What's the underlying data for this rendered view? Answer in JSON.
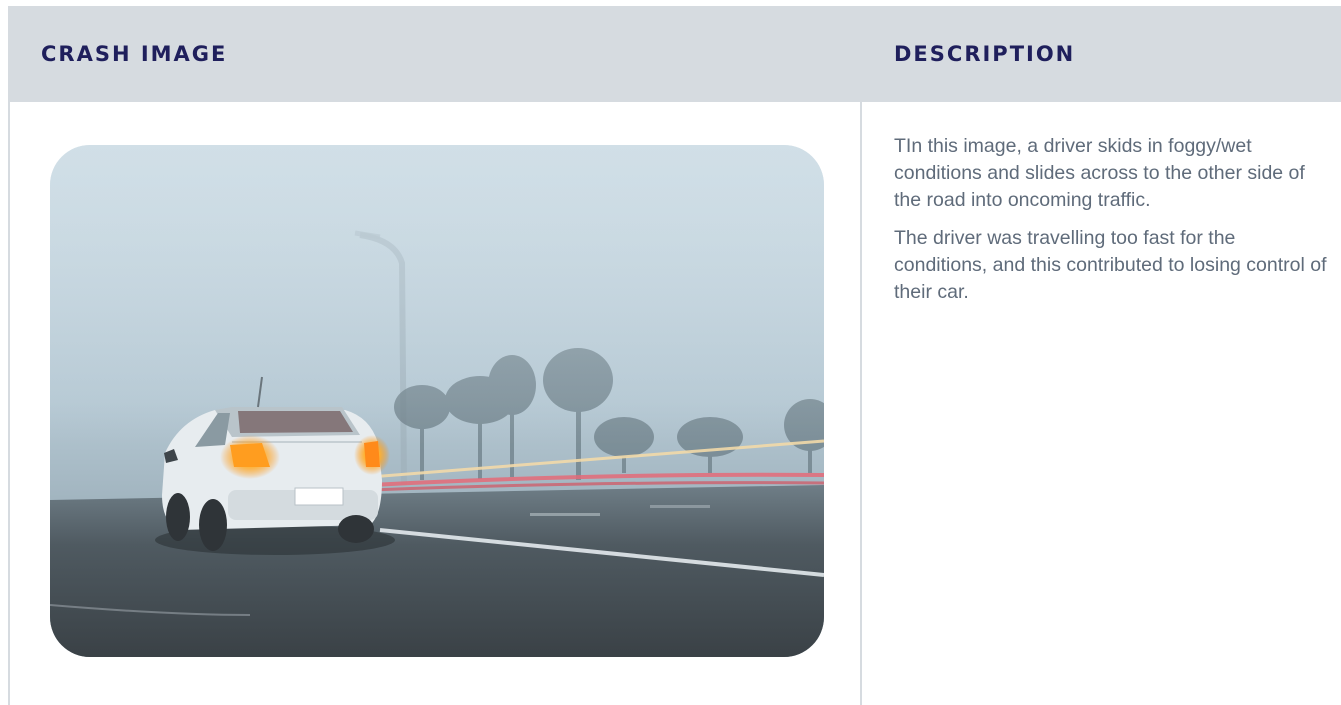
{
  "table": {
    "headers": [
      "CRASH IMAGE",
      "DESCRIPTION"
    ]
  },
  "image": {
    "icon": "crash-photo-foggy-road"
  },
  "description": {
    "paragraphs": [
      "TIn this image, a driver skids in foggy/wet conditions and slides across to the other side of the road into oncoming traffic.",
      "The driver was travelling too fast for the conditions, and this contributed to losing control of their car."
    ]
  },
  "colors": {
    "header_bg": "#d6dbe0",
    "header_text": "#1f1f5c",
    "body_text": "#5f6b7a"
  }
}
